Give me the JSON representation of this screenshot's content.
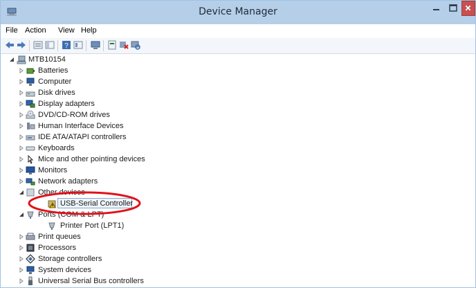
{
  "window": {
    "title": "Device Manager"
  },
  "menu": {
    "file": "File",
    "action": "Action",
    "view": "View",
    "help": "Help"
  },
  "toolbar": {
    "icons": [
      "back-icon",
      "forward-icon",
      "properties-icon",
      "console-tree-icon",
      "help-icon",
      "show-hide-icon",
      "computer-icon",
      "update-driver-icon",
      "uninstall-icon",
      "scan-icon"
    ]
  },
  "tree": {
    "root": "MTB10154",
    "items": [
      {
        "label": "Batteries",
        "icon": "battery-icon"
      },
      {
        "label": "Computer",
        "icon": "computer-icon"
      },
      {
        "label": "Disk drives",
        "icon": "disk-drive-icon"
      },
      {
        "label": "Display adapters",
        "icon": "display-adapter-icon"
      },
      {
        "label": "DVD/CD-ROM drives",
        "icon": "dvd-icon"
      },
      {
        "label": "Human Interface Devices",
        "icon": "hid-icon"
      },
      {
        "label": "IDE ATA/ATAPI controllers",
        "icon": "ide-icon"
      },
      {
        "label": "Keyboards",
        "icon": "keyboard-icon"
      },
      {
        "label": "Mice and other pointing devices",
        "icon": "mouse-icon"
      },
      {
        "label": "Monitors",
        "icon": "monitor-icon"
      },
      {
        "label": "Network adapters",
        "icon": "network-icon"
      },
      {
        "label": "Other devices",
        "icon": "other-device-icon"
      },
      {
        "label": "USB-Serial Controller",
        "icon": "warning-device-icon"
      },
      {
        "label": "Ports (COM & LPT)",
        "icon": "port-icon"
      },
      {
        "label": "Printer Port (LPT1)",
        "icon": "printer-port-icon"
      },
      {
        "label": "Print queues",
        "icon": "print-queue-icon"
      },
      {
        "label": "Processors",
        "icon": "processor-icon"
      },
      {
        "label": "Storage controllers",
        "icon": "storage-icon"
      },
      {
        "label": "System devices",
        "icon": "system-icon"
      },
      {
        "label": "Universal Serial Bus controllers",
        "icon": "usb-icon"
      }
    ]
  },
  "colors": {
    "titlebar": "#b5cfe9",
    "close": "#c75050",
    "highlight_ellipse": "#e0121a"
  }
}
